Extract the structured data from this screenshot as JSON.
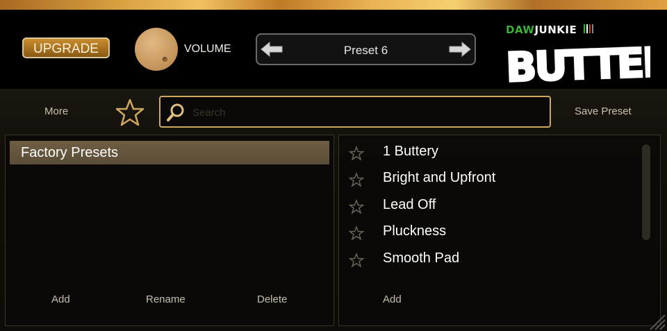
{
  "header": {
    "upgrade_label": "UPGRADE",
    "volume_label": "VOLUME",
    "preset_name": "Preset 6",
    "brand_daw": "DAW",
    "brand_junkie": "JUNKIE",
    "product_name": "BUTTER"
  },
  "toolbar": {
    "more_label": "More",
    "search_placeholder": "Search",
    "search_value": "",
    "save_preset_label": "Save Preset"
  },
  "banks": {
    "items": [
      {
        "label": "Factory Presets",
        "selected": true
      }
    ],
    "actions": {
      "add": "Add",
      "rename": "Rename",
      "delete": "Delete"
    }
  },
  "presets": {
    "items": [
      {
        "label": "1 Buttery",
        "favorite": false
      },
      {
        "label": "Bright and Upfront",
        "favorite": false
      },
      {
        "label": "Lead Off",
        "favorite": false
      },
      {
        "label": "Pluckness",
        "favorite": false
      },
      {
        "label": "Smooth Pad",
        "favorite": false
      }
    ],
    "actions": {
      "add": "Add"
    }
  },
  "colors": {
    "accent_gold": "#cfa860",
    "upgrade_orange": "#c98d2e",
    "selected_row": "#6e5e44",
    "brand_green": "#3fae3a"
  },
  "icons": {
    "prev_preset": "arrow-left-icon",
    "next_preset": "arrow-right-icon",
    "favorites_filter": "star-outline-icon",
    "search": "search-icon"
  }
}
